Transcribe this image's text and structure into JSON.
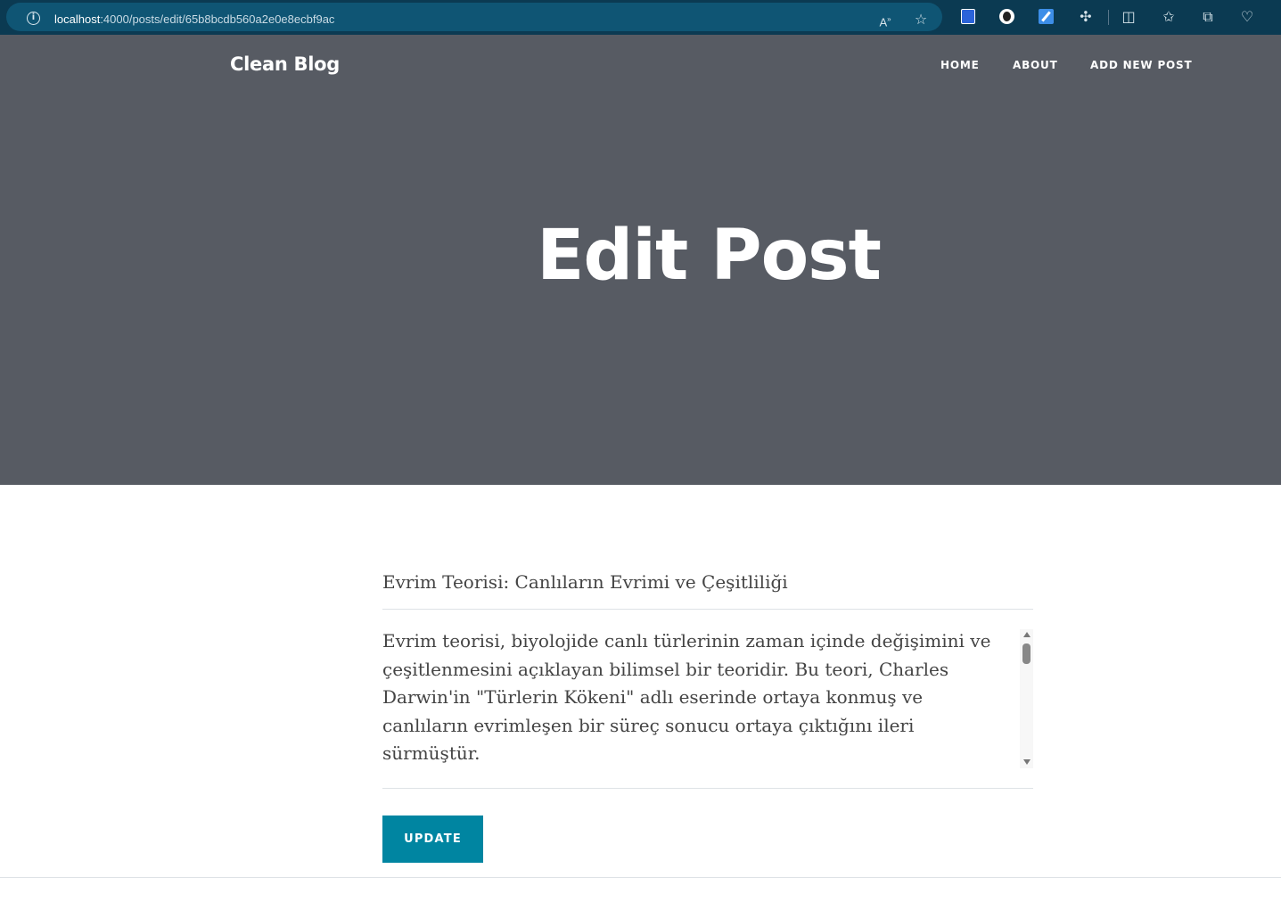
{
  "browser": {
    "url_host": "localhost",
    "url_path": ":4000/posts/edit/65b8bcdb560a2e0e8ecbf9ac",
    "icons": {
      "info": "info-icon",
      "read_aloud": "read-aloud-icon",
      "favorite": "star-icon",
      "extensions": "puzzle-icon",
      "split_screen": "split-screen-icon",
      "favorites_list": "favorites-icon",
      "collections": "collections-icon",
      "browser_essentials": "heart-icon"
    }
  },
  "nav": {
    "brand": "Clean Blog",
    "links": [
      "HOME",
      "ABOUT",
      "ADD NEW POST"
    ]
  },
  "header": {
    "heading": "Edit Post"
  },
  "form": {
    "title_value": "Evrim Teorisi: Canlıların Evrimi ve Çeşitliliği",
    "content_value": "Evrim teorisi, biyolojide canlı türlerinin zaman içinde değişimini ve çeşitlenmesini açıklayan bilimsel bir teoridir. Bu teori, Charles Darwin'in \"Türlerin Kökeni\" adlı eserinde ortaya konmuş ve canlıların evrimleşen bir süreç sonucu ortaya çıktığını ileri sürmüştür.",
    "submit_label": "UPDATE"
  },
  "colors": {
    "header_bg": "#575b63",
    "button_bg": "#0085a1",
    "browser_bg": "#0b3a52"
  }
}
